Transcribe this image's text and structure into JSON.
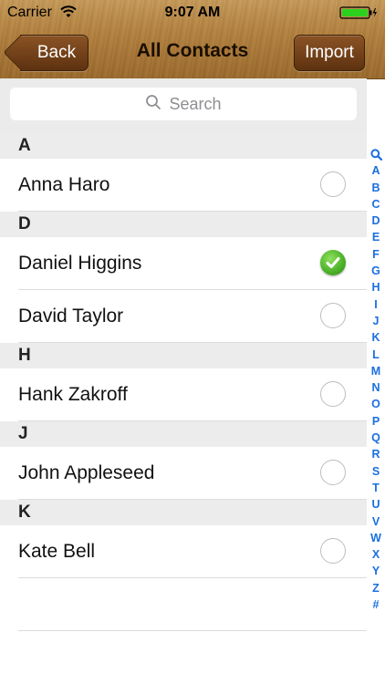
{
  "status_bar": {
    "carrier": "Carrier",
    "time": "9:07 AM"
  },
  "nav": {
    "back_label": "Back",
    "title": "All Contacts",
    "import_label": "Import"
  },
  "search": {
    "placeholder": "Search"
  },
  "sections": [
    {
      "header": "A",
      "rows": [
        {
          "name": "Anna Haro",
          "selected": false
        }
      ]
    },
    {
      "header": "D",
      "rows": [
        {
          "name": "Daniel Higgins",
          "selected": true
        },
        {
          "name": "David Taylor",
          "selected": false
        }
      ]
    },
    {
      "header": "H",
      "rows": [
        {
          "name": "Hank Zakroff",
          "selected": false
        }
      ]
    },
    {
      "header": "J",
      "rows": [
        {
          "name": "John Appleseed",
          "selected": false
        }
      ]
    },
    {
      "header": "K",
      "rows": [
        {
          "name": "Kate Bell",
          "selected": false
        }
      ]
    }
  ],
  "index_letters": [
    "A",
    "B",
    "C",
    "D",
    "E",
    "F",
    "G",
    "H",
    "I",
    "J",
    "K",
    "L",
    "M",
    "N",
    "O",
    "P",
    "Q",
    "R",
    "S",
    "T",
    "U",
    "V",
    "W",
    "X",
    "Y",
    "Z",
    "#"
  ],
  "icons": {
    "wifi": "wifi-icon",
    "battery": "battery-icon",
    "search": "search-icon",
    "checkmark": "checkmark-icon",
    "index_search": "magnifier-icon"
  },
  "colors": {
    "accent": "#1a6fe0",
    "check_green": "#4fb42a",
    "nav_wood": "#b4823f",
    "button_brown": "#6b3c17"
  }
}
